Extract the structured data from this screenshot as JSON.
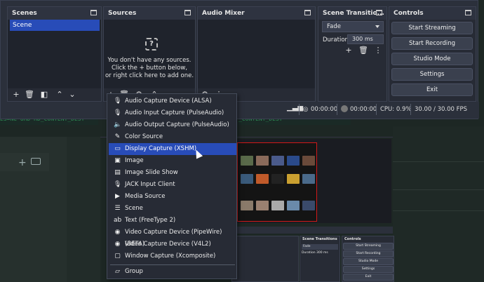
{
  "background": {
    "terminal_text": "ES=Ne UHD HD_CONTENT_DEST",
    "terminal_text2": "_CONTENT_DEST"
  },
  "scenes": {
    "title": "Scenes",
    "items": [
      "Scene"
    ]
  },
  "sources": {
    "title": "Sources",
    "empty_line1": "You don't have any sources.",
    "empty_line2": "Click the + button below,",
    "empty_line3": "or right click here to add one."
  },
  "audio_mixer": {
    "title": "Audio Mixer"
  },
  "transitions": {
    "title": "Scene Transitio...",
    "selected": "Fade",
    "duration_label": "Duration",
    "duration_value": "300 ms"
  },
  "controls": {
    "title": "Controls",
    "buttons": [
      "Start Streaming",
      "Start Recording",
      "Studio Mode",
      "Settings",
      "Exit"
    ]
  },
  "status": {
    "stream_time": "00:00:00",
    "rec_time": "00:00:00",
    "cpu": "CPU: 0.9%",
    "fps": "30.00 / 30.00 FPS"
  },
  "context_menu": {
    "items": [
      {
        "label": "Audio Capture Device (ALSA)",
        "icon": "microphone-icon"
      },
      {
        "label": "Audio Input Capture (PulseAudio)",
        "icon": "microphone-icon"
      },
      {
        "label": "Audio Output Capture (PulseAudio)",
        "icon": "speaker-icon"
      },
      {
        "label": "Color Source",
        "icon": "paint-brush-icon"
      },
      {
        "label": "Display Capture (XSHM)",
        "icon": "monitor-icon"
      },
      {
        "label": "Image",
        "icon": "image-icon"
      },
      {
        "label": "Image Slide Show",
        "icon": "slideshow-icon"
      },
      {
        "label": "JACK Input Client",
        "icon": "microphone-icon"
      },
      {
        "label": "Media Source",
        "icon": "play-icon"
      },
      {
        "label": "Scene",
        "icon": "list-icon"
      },
      {
        "label": "Text (FreeType 2)",
        "icon": "text-icon"
      },
      {
        "label": "Video Capture Device (PipeWire) (BETA)",
        "icon": "camera-icon"
      },
      {
        "label": "Video Capture Device (V4L2)",
        "icon": "camera-icon"
      },
      {
        "label": "Window Capture (Xcomposite)",
        "icon": "window-icon"
      },
      {
        "label": "Group",
        "icon": "folder-icon"
      }
    ],
    "selected_index": 4
  },
  "mini_preview": {
    "transitions_title": "Scene Transitions",
    "controls_title": "Controls",
    "fade": "Fade",
    "duration_label": "Duration",
    "duration_value": "300 ms",
    "buttons": [
      "Start Streaming",
      "Start Recording",
      "Studio Mode",
      "Settings",
      "Exit"
    ]
  },
  "colors": {
    "accent": "#284cb8",
    "window_bg": "#2b303b",
    "dock_bg": "#1f232c",
    "recording_border": "#d01818"
  }
}
